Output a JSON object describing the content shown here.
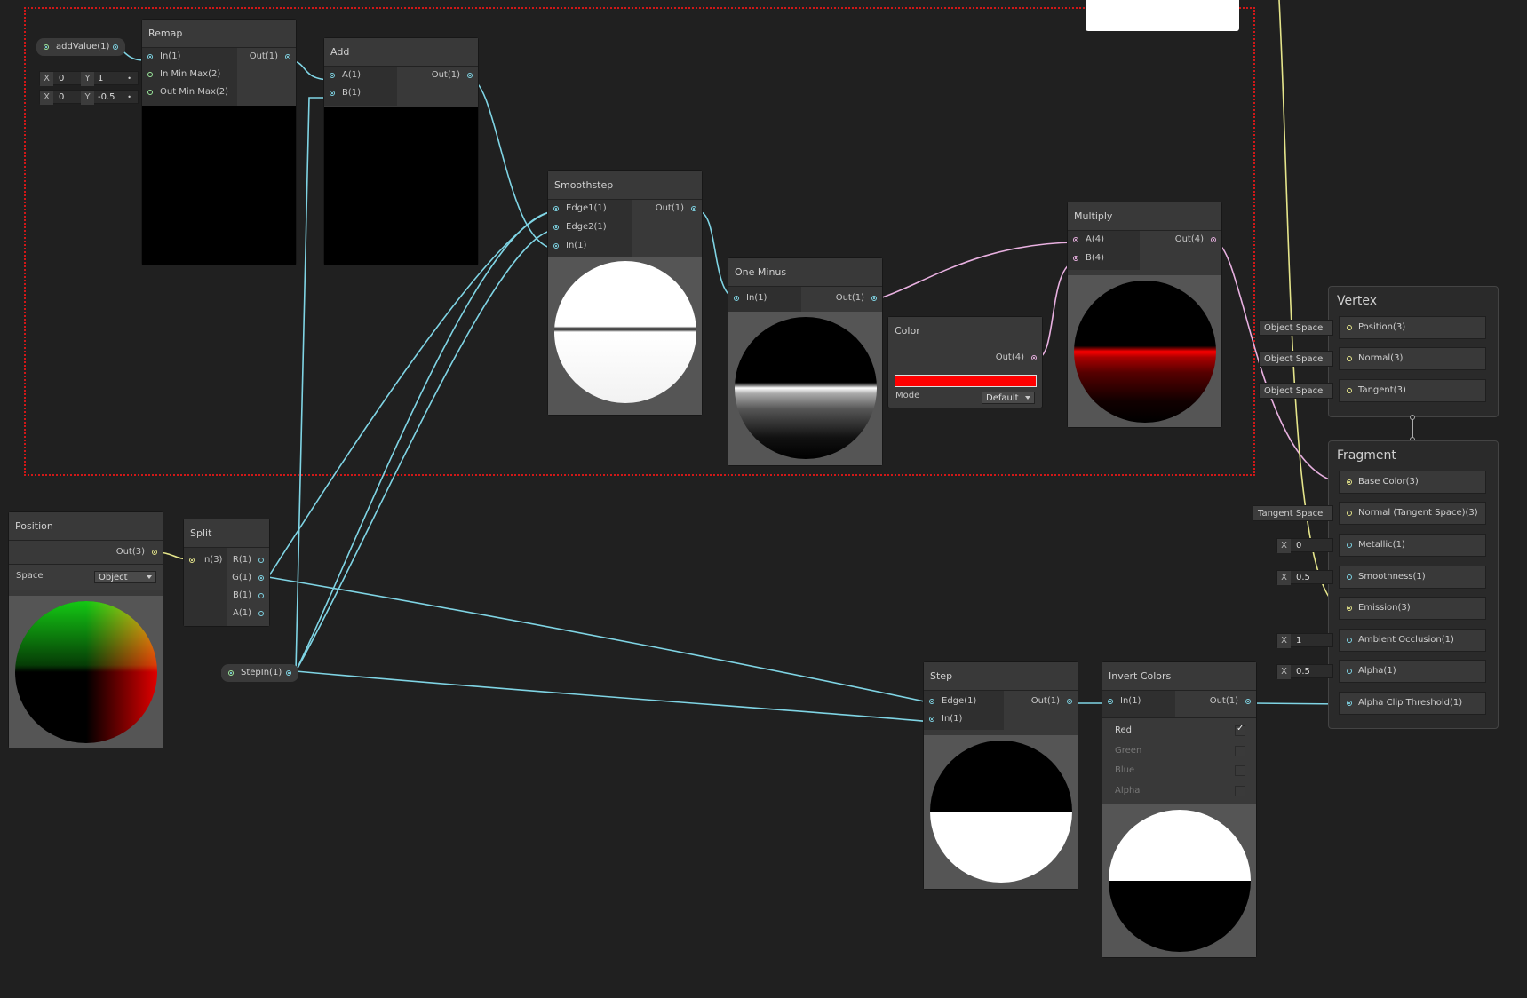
{
  "remap": {
    "title": "Remap",
    "in": "In(1)",
    "in_min_max": "In Min Max(2)",
    "out_min_max": "Out Min Max(2)",
    "out": "Out(1)",
    "inmm_x": "0",
    "inmm_y": "1",
    "outmm_x": "0",
    "outmm_y": "-0.5"
  },
  "add_value": {
    "label": "addValue(1)"
  },
  "add": {
    "title": "Add",
    "a": "A(1)",
    "b": "B(1)",
    "out": "Out(1)"
  },
  "smoothstep": {
    "title": "Smoothstep",
    "edge1": "Edge1(1)",
    "edge2": "Edge2(1)",
    "in": "In(1)",
    "out": "Out(1)"
  },
  "one_minus": {
    "title": "One Minus",
    "in": "In(1)",
    "out": "Out(1)"
  },
  "color": {
    "title": "Color",
    "out": "Out(4)",
    "mode_label": "Mode",
    "mode_value": "Default",
    "swatch": "#ff0000"
  },
  "multiply": {
    "title": "Multiply",
    "a": "A(4)",
    "b": "B(4)",
    "out": "Out(4)"
  },
  "position": {
    "title": "Position",
    "out": "Out(3)",
    "space_label": "Space",
    "space_value": "Object"
  },
  "split": {
    "title": "Split",
    "in": "In(3)",
    "r": "R(1)",
    "g": "G(1)",
    "b": "B(1)",
    "a": "A(1)"
  },
  "step_in": {
    "label": "StepIn(1)"
  },
  "step": {
    "title": "Step",
    "edge": "Edge(1)",
    "in": "In(1)",
    "out": "Out(1)"
  },
  "invert": {
    "title": "Invert Colors",
    "in": "In(1)",
    "out": "Out(1)",
    "red": "Red",
    "green": "Green",
    "blue": "Blue",
    "alpha": "Alpha"
  },
  "vertex": {
    "title": "Vertex",
    "position": "Position(3)",
    "normal": "Normal(3)",
    "tangent": "Tangent(3)",
    "space_tag": "Object Space"
  },
  "fragment": {
    "title": "Fragment",
    "base_color": "Base Color(3)",
    "normal_ts": "Normal (Tangent Space)(3)",
    "metallic": "Metallic(1)",
    "smoothness": "Smoothness(1)",
    "emission": "Emission(3)",
    "ao": "Ambient Occlusion(1)",
    "alpha": "Alpha(1)",
    "alpha_clip": "Alpha Clip Threshold(1)",
    "tangent_space_tag": "Tangent Space",
    "x_label": "X",
    "metallic_value": "0",
    "smoothness_value": "0.5",
    "ao_value": "1",
    "alpha_value": "0.5"
  },
  "colors": {
    "wire_float": "#7fd4e4",
    "wire_vector3": "#e4e48a",
    "wire_vector4": "#e8b0e0",
    "selection": "#d01818",
    "background": "#202020"
  }
}
